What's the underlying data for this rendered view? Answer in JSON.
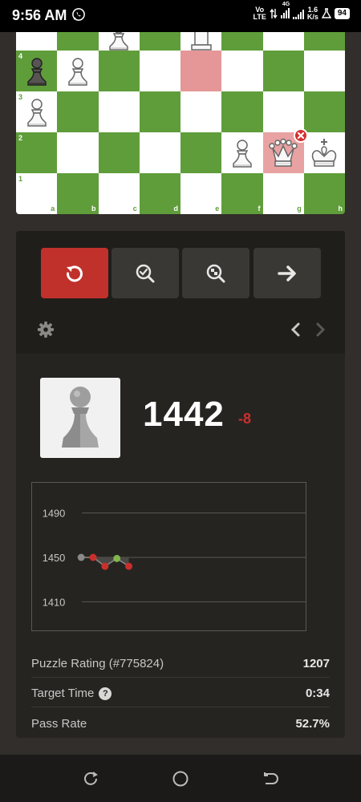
{
  "status_bar": {
    "time": "9:56 AM",
    "network_top": "Vo",
    "network_bottom": "LTE",
    "network_type": "4G",
    "speed_value": "1.6",
    "speed_unit": "K/s",
    "battery": "94",
    "icons": [
      "whatsapp-icon",
      "data-arrows-icon",
      "signal-icon",
      "signal-icon",
      "flask-icon",
      "battery-icon"
    ]
  },
  "board": {
    "ranks": [
      "4",
      "3",
      "2",
      "1"
    ],
    "files": [
      "a",
      "b",
      "c",
      "d",
      "e",
      "f",
      "g",
      "h"
    ],
    "colors": {
      "light": "#ffffff",
      "dark": "#5f9d3a",
      "highlight": "#e59696"
    },
    "pieces": [
      {
        "square": "c5",
        "piece": "white-pawn"
      },
      {
        "square": "e5",
        "piece": "white-rook"
      },
      {
        "square": "a4",
        "piece": "black-pawn"
      },
      {
        "square": "b4",
        "piece": "white-pawn"
      },
      {
        "square": "a3",
        "piece": "white-pawn"
      },
      {
        "square": "f2",
        "piece": "white-pawn"
      },
      {
        "square": "g2",
        "piece": "white-queen"
      },
      {
        "square": "h2",
        "piece": "white-king"
      }
    ],
    "highlighted_squares": [
      "e4",
      "g2"
    ],
    "error_marker_square": "g2"
  },
  "controls": {
    "retry_icon": "retry-icon",
    "hint_icon": "magnifier-check-icon",
    "analysis_icon": "magnifier-icon",
    "next_icon": "arrow-right-icon",
    "settings_icon": "gear-icon",
    "prev_icon": "chevron-left-icon",
    "next_small_icon": "chevron-right-icon",
    "accent_color": "#c0312c"
  },
  "player": {
    "avatar_icon": "pawn-icon",
    "rating": "1442",
    "rating_change": "-8"
  },
  "chart_data": {
    "type": "line",
    "y_ticks": [
      "1490",
      "1450",
      "1410"
    ],
    "ylim": [
      1410,
      1490
    ],
    "points": [
      {
        "x": 1,
        "y": 1450,
        "result": "neutral"
      },
      {
        "x": 2,
        "y": 1450,
        "result": "fail"
      },
      {
        "x": 3,
        "y": 1442,
        "result": "fail"
      },
      {
        "x": 4,
        "y": 1449,
        "result": "pass"
      },
      {
        "x": 5,
        "y": 1442,
        "result": "fail"
      }
    ],
    "colors": {
      "pass": "#81b64c",
      "fail": "#c9302c",
      "neutral": "#8b8987",
      "grid": "#5a5855"
    },
    "grid": true
  },
  "stats": [
    {
      "label": "Puzzle Rating (#775824)",
      "value": "1207"
    },
    {
      "label": "Target Time",
      "value": "0:34",
      "help_icon": "question-icon"
    },
    {
      "label": "Pass Rate",
      "value": "52.7%"
    }
  ],
  "nav_bar": {
    "icons": [
      "recent-apps-icon",
      "home-icon",
      "back-icon"
    ]
  }
}
